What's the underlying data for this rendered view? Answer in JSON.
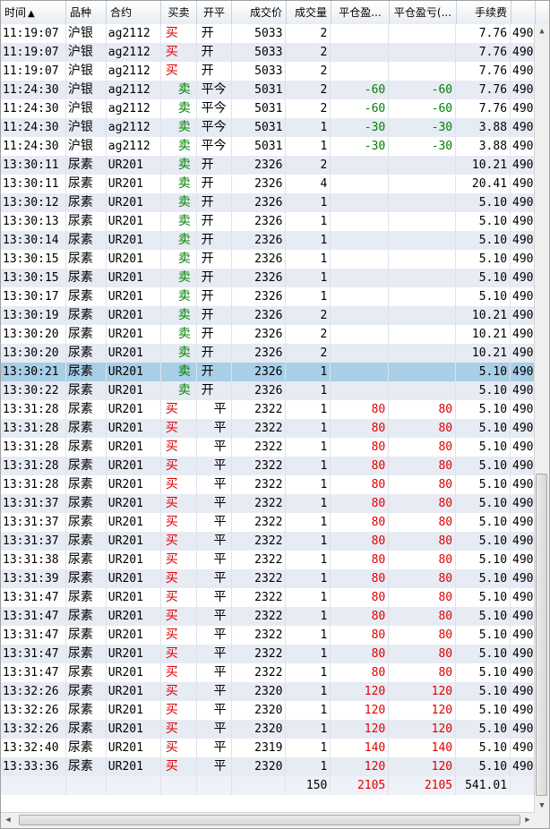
{
  "columns": [
    {
      "label": "时间",
      "sort": "▲"
    },
    {
      "label": "品种"
    },
    {
      "label": "合约"
    },
    {
      "label": "买卖"
    },
    {
      "label": "开平"
    },
    {
      "label": "成交价"
    },
    {
      "label": "成交量"
    },
    {
      "label": "平仓盈..."
    },
    {
      "label": "平仓盈亏(..."
    },
    {
      "label": "手续费"
    },
    {
      "label": ""
    }
  ],
  "rows": [
    [
      "11:19:07",
      "沪银",
      "ag2112",
      "买",
      "开",
      "5033",
      "2",
      "",
      "",
      "7.76",
      "490"
    ],
    [
      "11:19:07",
      "沪银",
      "ag2112",
      "买",
      "开",
      "5033",
      "2",
      "",
      "",
      "7.76",
      "490"
    ],
    [
      "11:19:07",
      "沪银",
      "ag2112",
      "买",
      "开",
      "5033",
      "2",
      "",
      "",
      "7.76",
      "490"
    ],
    [
      "11:24:30",
      "沪银",
      "ag2112",
      "卖",
      "平今",
      "5031",
      "2",
      "-60",
      "-60",
      "7.76",
      "490"
    ],
    [
      "11:24:30",
      "沪银",
      "ag2112",
      "卖",
      "平今",
      "5031",
      "2",
      "-60",
      "-60",
      "7.76",
      "490"
    ],
    [
      "11:24:30",
      "沪银",
      "ag2112",
      "卖",
      "平今",
      "5031",
      "1",
      "-30",
      "-30",
      "3.88",
      "490"
    ],
    [
      "11:24:30",
      "沪银",
      "ag2112",
      "卖",
      "平今",
      "5031",
      "1",
      "-30",
      "-30",
      "3.88",
      "490"
    ],
    [
      "13:30:11",
      "尿素",
      "UR201",
      "卖",
      "开",
      "2326",
      "2",
      "",
      "",
      "10.21",
      "490"
    ],
    [
      "13:30:11",
      "尿素",
      "UR201",
      "卖",
      "开",
      "2326",
      "4",
      "",
      "",
      "20.41",
      "490"
    ],
    [
      "13:30:12",
      "尿素",
      "UR201",
      "卖",
      "开",
      "2326",
      "1",
      "",
      "",
      "5.10",
      "490"
    ],
    [
      "13:30:13",
      "尿素",
      "UR201",
      "卖",
      "开",
      "2326",
      "1",
      "",
      "",
      "5.10",
      "490"
    ],
    [
      "13:30:14",
      "尿素",
      "UR201",
      "卖",
      "开",
      "2326",
      "1",
      "",
      "",
      "5.10",
      "490"
    ],
    [
      "13:30:15",
      "尿素",
      "UR201",
      "卖",
      "开",
      "2326",
      "1",
      "",
      "",
      "5.10",
      "490"
    ],
    [
      "13:30:15",
      "尿素",
      "UR201",
      "卖",
      "开",
      "2326",
      "1",
      "",
      "",
      "5.10",
      "490"
    ],
    [
      "13:30:17",
      "尿素",
      "UR201",
      "卖",
      "开",
      "2326",
      "1",
      "",
      "",
      "5.10",
      "490"
    ],
    [
      "13:30:19",
      "尿素",
      "UR201",
      "卖",
      "开",
      "2326",
      "2",
      "",
      "",
      "10.21",
      "490"
    ],
    [
      "13:30:20",
      "尿素",
      "UR201",
      "卖",
      "开",
      "2326",
      "2",
      "",
      "",
      "10.21",
      "490"
    ],
    [
      "13:30:20",
      "尿素",
      "UR201",
      "卖",
      "开",
      "2326",
      "2",
      "",
      "",
      "10.21",
      "490"
    ],
    [
      "13:30:21",
      "尿素",
      "UR201",
      "卖",
      "开",
      "2326",
      "1",
      "",
      "",
      "5.10",
      "490"
    ],
    [
      "13:30:22",
      "尿素",
      "UR201",
      "卖",
      "开",
      "2326",
      "1",
      "",
      "",
      "5.10",
      "490"
    ],
    [
      "13:31:28",
      "尿素",
      "UR201",
      "买",
      "平",
      "2322",
      "1",
      "80",
      "80",
      "5.10",
      "490"
    ],
    [
      "13:31:28",
      "尿素",
      "UR201",
      "买",
      "平",
      "2322",
      "1",
      "80",
      "80",
      "5.10",
      "490"
    ],
    [
      "13:31:28",
      "尿素",
      "UR201",
      "买",
      "平",
      "2322",
      "1",
      "80",
      "80",
      "5.10",
      "490"
    ],
    [
      "13:31:28",
      "尿素",
      "UR201",
      "买",
      "平",
      "2322",
      "1",
      "80",
      "80",
      "5.10",
      "490"
    ],
    [
      "13:31:28",
      "尿素",
      "UR201",
      "买",
      "平",
      "2322",
      "1",
      "80",
      "80",
      "5.10",
      "490"
    ],
    [
      "13:31:37",
      "尿素",
      "UR201",
      "买",
      "平",
      "2322",
      "1",
      "80",
      "80",
      "5.10",
      "490"
    ],
    [
      "13:31:37",
      "尿素",
      "UR201",
      "买",
      "平",
      "2322",
      "1",
      "80",
      "80",
      "5.10",
      "490"
    ],
    [
      "13:31:37",
      "尿素",
      "UR201",
      "买",
      "平",
      "2322",
      "1",
      "80",
      "80",
      "5.10",
      "490"
    ],
    [
      "13:31:38",
      "尿素",
      "UR201",
      "买",
      "平",
      "2322",
      "1",
      "80",
      "80",
      "5.10",
      "490"
    ],
    [
      "13:31:39",
      "尿素",
      "UR201",
      "买",
      "平",
      "2322",
      "1",
      "80",
      "80",
      "5.10",
      "490"
    ],
    [
      "13:31:47",
      "尿素",
      "UR201",
      "买",
      "平",
      "2322",
      "1",
      "80",
      "80",
      "5.10",
      "490"
    ],
    [
      "13:31:47",
      "尿素",
      "UR201",
      "买",
      "平",
      "2322",
      "1",
      "80",
      "80",
      "5.10",
      "490"
    ],
    [
      "13:31:47",
      "尿素",
      "UR201",
      "买",
      "平",
      "2322",
      "1",
      "80",
      "80",
      "5.10",
      "490"
    ],
    [
      "13:31:47",
      "尿素",
      "UR201",
      "买",
      "平",
      "2322",
      "1",
      "80",
      "80",
      "5.10",
      "490"
    ],
    [
      "13:31:47",
      "尿素",
      "UR201",
      "买",
      "平",
      "2322",
      "1",
      "80",
      "80",
      "5.10",
      "490"
    ],
    [
      "13:32:26",
      "尿素",
      "UR201",
      "买",
      "平",
      "2320",
      "1",
      "120",
      "120",
      "5.10",
      "490"
    ],
    [
      "13:32:26",
      "尿素",
      "UR201",
      "买",
      "平",
      "2320",
      "1",
      "120",
      "120",
      "5.10",
      "490"
    ],
    [
      "13:32:26",
      "尿素",
      "UR201",
      "买",
      "平",
      "2320",
      "1",
      "120",
      "120",
      "5.10",
      "490"
    ],
    [
      "13:32:40",
      "尿素",
      "UR201",
      "买",
      "平",
      "2319",
      "1",
      "140",
      "140",
      "5.10",
      "490"
    ],
    [
      "13:33:36",
      "尿素",
      "UR201",
      "买",
      "平",
      "2320",
      "1",
      "120",
      "120",
      "5.10",
      "490"
    ]
  ],
  "selected_row": 18,
  "totals": {
    "volume": "150",
    "close_pnl": "2105",
    "close_pnl2": "2105",
    "fee": "541.01"
  },
  "scroll": {
    "left_arrow": "◀",
    "right_arrow": "▶",
    "up_arrow": "▲",
    "down_arrow": "▼"
  },
  "colors": {
    "buy": "#e00000",
    "sell": "#008000",
    "profit": "#e00000",
    "loss": "#008000",
    "selected": "#a8cfe6"
  }
}
